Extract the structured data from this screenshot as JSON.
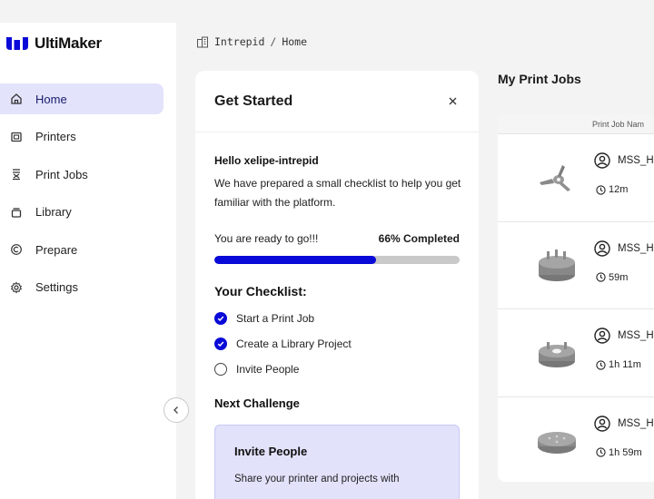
{
  "brand": {
    "name": "UltiMaker",
    "accent": "#0a0ad8"
  },
  "sidebar": {
    "items": [
      {
        "label": "Home",
        "icon": "home-icon",
        "active": true
      },
      {
        "label": "Printers",
        "icon": "printer-icon",
        "active": false
      },
      {
        "label": "Print Jobs",
        "icon": "print-jobs-icon",
        "active": false
      },
      {
        "label": "Library",
        "icon": "library-icon",
        "active": false
      },
      {
        "label": "Prepare",
        "icon": "prepare-icon",
        "active": false
      },
      {
        "label": "Settings",
        "icon": "gear-icon",
        "active": false
      }
    ],
    "collapse_icon": "chevron-left-icon"
  },
  "breadcrumb": {
    "icon": "building-icon",
    "org": "Intrepid",
    "separator": "/",
    "page": "Home"
  },
  "get_started": {
    "title": "Get Started",
    "close_icon": "close-icon",
    "greeting": "Hello xelipe-intrepid",
    "intro": "We have prepared a small checklist to help you get familiar with the platform.",
    "status": "You are ready to go!!!",
    "progress_label": "66% Completed",
    "progress": 0.66,
    "checklist_title": "Your Checklist:",
    "checklist": [
      {
        "label": "Start a Print Job",
        "done": true
      },
      {
        "label": "Create a Library Project",
        "done": true
      },
      {
        "label": "Invite People",
        "done": false
      }
    ],
    "next_challenge_title": "Next Challenge",
    "challenge": {
      "title": "Invite People",
      "text": "Share your printer and projects with"
    }
  },
  "print_jobs": {
    "title": "My Print Jobs",
    "column_header": "Print Job Nam",
    "rows": [
      {
        "name": "MSS_H",
        "duration": "12m",
        "thumb": "tripod-part-thumbnail"
      },
      {
        "name": "MSS_H",
        "duration": "59m",
        "thumb": "cylinder-part-thumbnail"
      },
      {
        "name": "MSS_H",
        "duration": "1h 11m",
        "thumb": "ring-part-thumbnail"
      },
      {
        "name": "MSS_H",
        "duration": "1h 59m",
        "thumb": "disc-part-thumbnail"
      }
    ]
  }
}
